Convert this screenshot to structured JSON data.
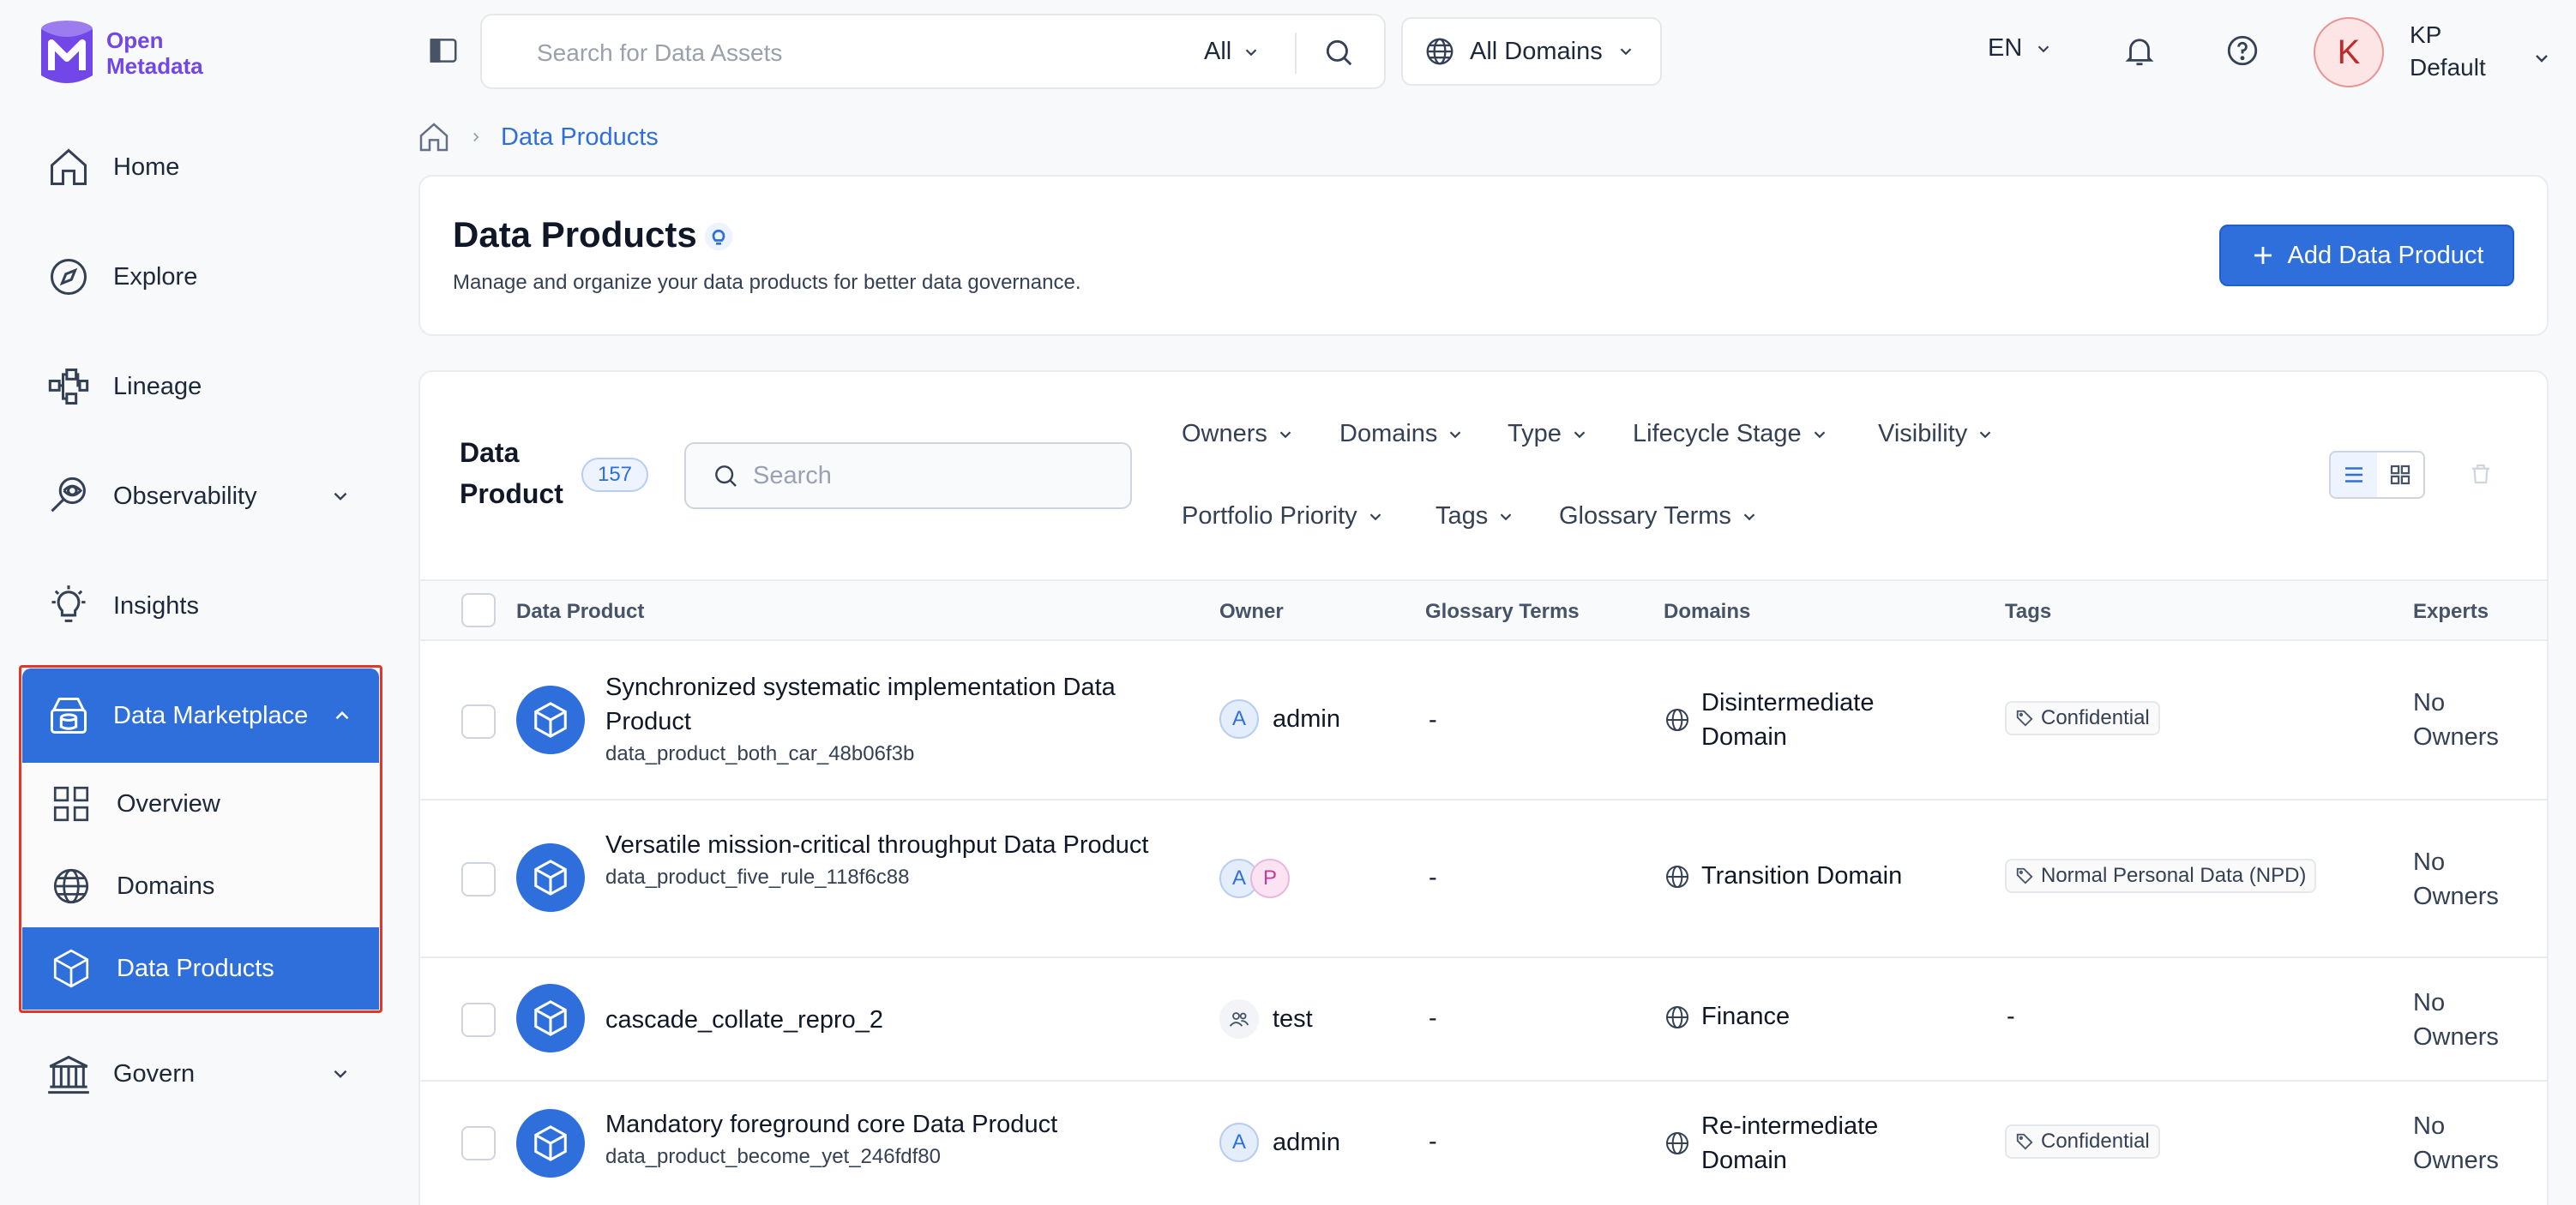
{
  "app": {
    "logo_line1": "Open",
    "logo_line2": "Metadata"
  },
  "sidebar": {
    "items": [
      {
        "label": "Home"
      },
      {
        "label": "Explore"
      },
      {
        "label": "Lineage"
      },
      {
        "label": "Observability"
      },
      {
        "label": "Insights"
      },
      {
        "label": "Data Marketplace"
      },
      {
        "label": "Govern"
      }
    ],
    "marketplace_sub": [
      {
        "label": "Overview"
      },
      {
        "label": "Domains"
      },
      {
        "label": "Data Products"
      }
    ]
  },
  "topbar": {
    "search_placeholder": "Search for Data Assets",
    "search_scope": "All",
    "domains_label": "All Domains",
    "language": "EN",
    "user_initial": "K",
    "user_short": "KP",
    "user_role": "Default"
  },
  "breadcrumb": {
    "current": "Data Products"
  },
  "header": {
    "title": "Data Products",
    "description": "Manage and organize your data products for better data governance.",
    "add_button": "Add Data Product"
  },
  "table_card": {
    "title_line1": "Data",
    "title_line2": "Product",
    "count": "157",
    "search_placeholder": "Search",
    "filters": [
      "Owners",
      "Domains",
      "Type",
      "Lifecycle Stage",
      "Visibility",
      "Portfolio Priority",
      "Tags",
      "Glossary Terms"
    ],
    "columns": [
      "Data Product",
      "Owner",
      "Glossary Terms",
      "Domains",
      "Tags",
      "Experts"
    ],
    "rows": [
      {
        "name": "Synchronized systematic implementation Data Product",
        "fqn": "data_product_both_car_48b06f3b",
        "owner_initial": "A",
        "owner": "admin",
        "glossary": "-",
        "domain": "Disintermediate Domain",
        "tag": "Confidential",
        "experts": "No Owners"
      },
      {
        "name": "Versatile mission-critical throughput Data Product",
        "fqn": "data_product_five_rule_118f6c88",
        "owner_initial": "A",
        "owner_initial2": "P",
        "glossary": "-",
        "domain": "Transition Domain",
        "tag": "Normal Personal Data (NPD)",
        "experts": "No Owners"
      },
      {
        "name": "cascade_collate_repro_2",
        "owner": "test",
        "glossary": "-",
        "domain": "Finance",
        "tag": "-",
        "experts": "No Owners"
      },
      {
        "name": "Mandatory foreground core Data Product",
        "fqn": "data_product_become_yet_246fdf80",
        "owner_initial": "A",
        "owner": "admin",
        "glossary": "-",
        "domain": "Re-intermediate Domain",
        "tag": "Confidential",
        "experts": "No Owners"
      }
    ]
  },
  "colors": {
    "accent": "#2e6fdc",
    "highlight_border": "#e0362c",
    "brand": "#7147e8"
  }
}
